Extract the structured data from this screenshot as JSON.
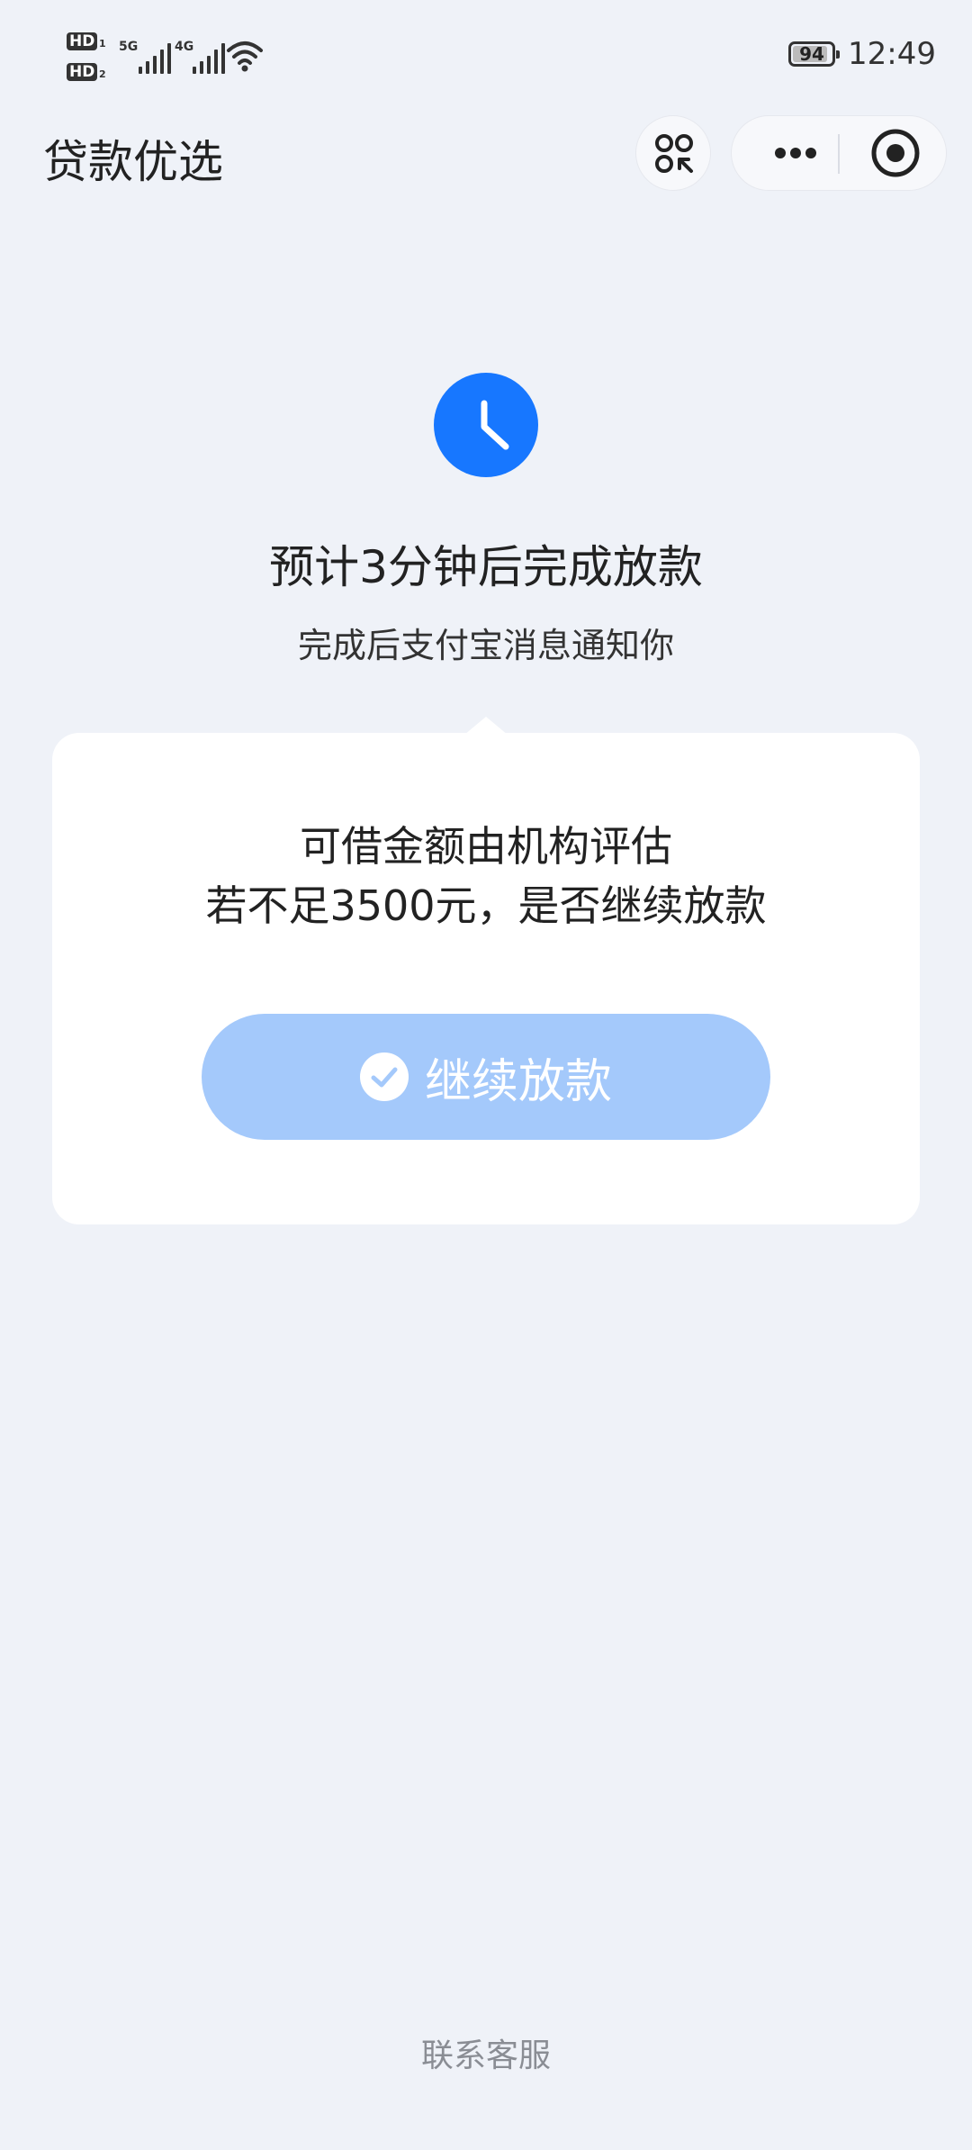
{
  "status_bar": {
    "sim1_label": "HD",
    "sim1_index": "1",
    "sim2_label": "HD",
    "sim2_index": "2",
    "network_1": "5G",
    "network_2": "4G",
    "battery_level": "94",
    "time": "12:49"
  },
  "header": {
    "title": "贷款优选",
    "icons": [
      "scan-exit-icon",
      "more-dots-icon",
      "target-circle-icon"
    ]
  },
  "status": {
    "icon": "clock-icon",
    "headline": "预计3分钟后完成放款",
    "subline": "完成后支付宝消息通知你"
  },
  "card": {
    "line1": "可借金额由机构评估",
    "line2": "若不足3500元，是否继续放款",
    "button_label": "继续放款",
    "button_icon": "check-circle-icon"
  },
  "footer": {
    "contact_label": "联系客服"
  },
  "colors": {
    "background": "#eff2f8",
    "accent": "#1777ff",
    "button": "#a4c9fb",
    "card": "#ffffff"
  }
}
